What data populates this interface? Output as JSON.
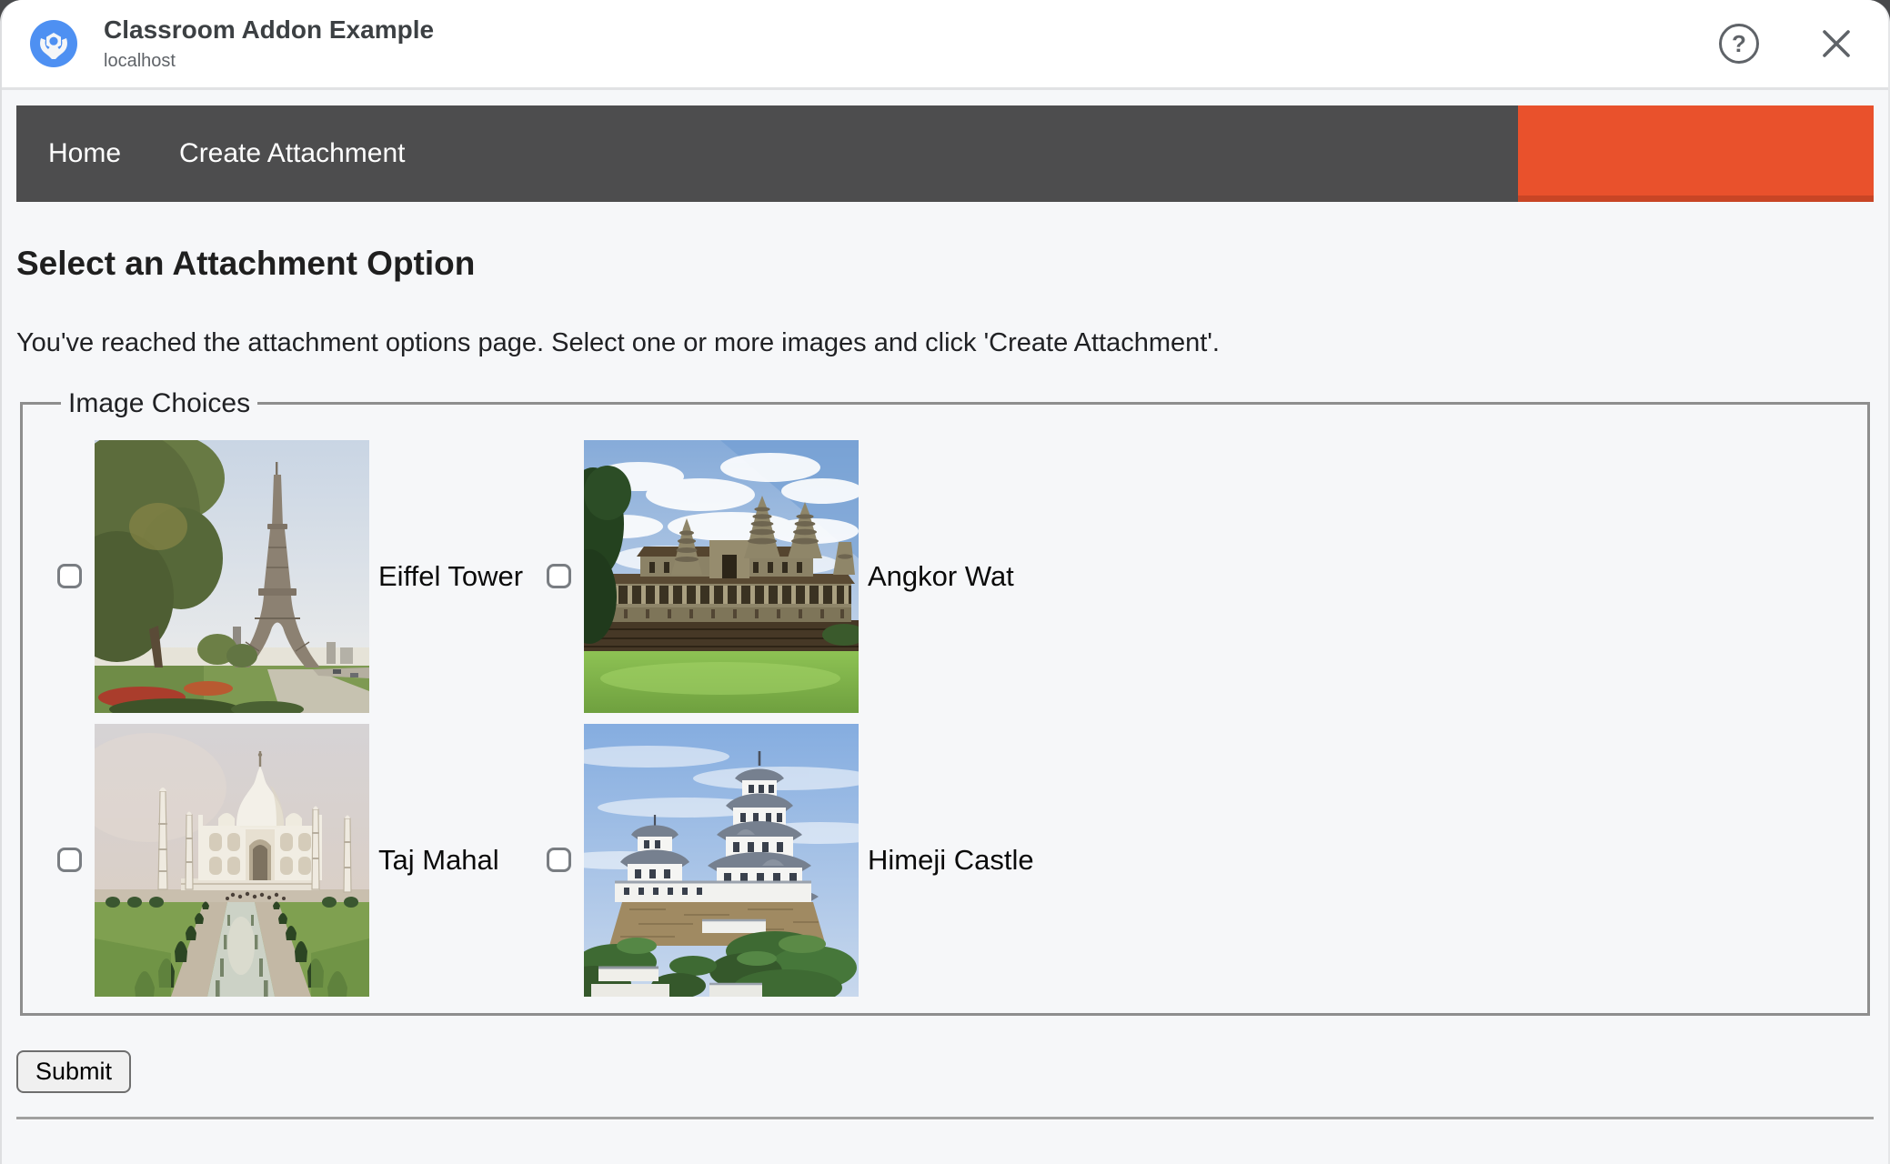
{
  "window": {
    "title": "Classroom Addon Example",
    "subtitle": "localhost",
    "help_glyph": "?",
    "close_glyph": "✕"
  },
  "nav": {
    "home_label": "Home",
    "create_attachment_label": "Create Attachment"
  },
  "main": {
    "heading": "Select an Attachment Option",
    "intro": "You've reached the attachment options page. Select one or more images and click 'Create Attachment'.",
    "image_choices": {
      "legend": "Image Choices",
      "choices": [
        {
          "label": "Eiffel Tower",
          "checked": false,
          "image": "eiffel-tower"
        },
        {
          "label": "Angkor Wat",
          "checked": false,
          "image": "angkor-wat"
        },
        {
          "label": "Taj Mahal",
          "checked": false,
          "image": "taj-mahal"
        },
        {
          "label": "Himeji Castle",
          "checked": false,
          "image": "himeji-castle"
        }
      ]
    },
    "submit_label": "Submit"
  },
  "colors": {
    "accent_orange": "#E9512C",
    "navbar_gray": "#4D4D4E",
    "page_background": "#F6F7F9",
    "logo_blue": "#4E90F2",
    "icon_gray": "#5F6368"
  }
}
